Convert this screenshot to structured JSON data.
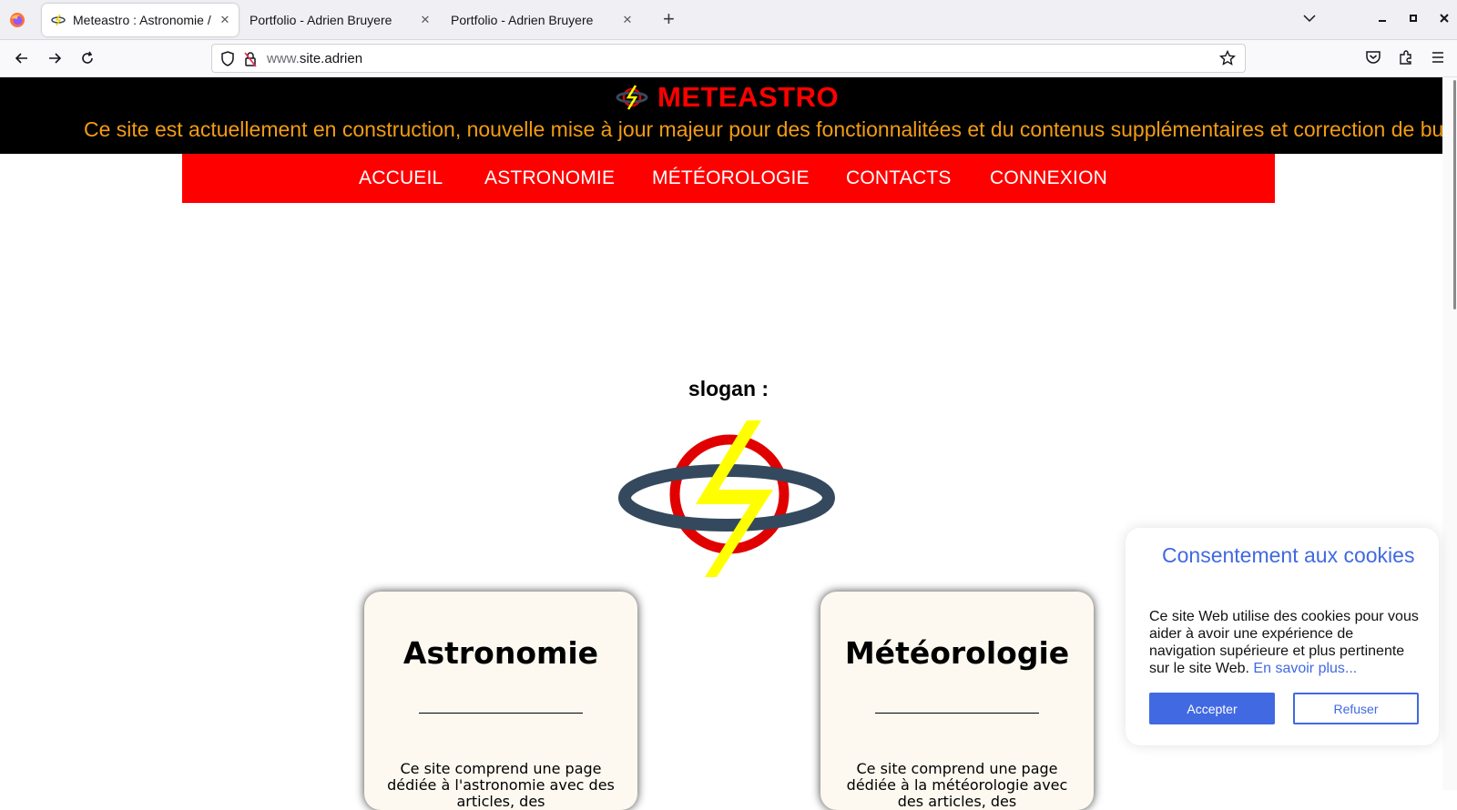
{
  "browser": {
    "tabs": [
      {
        "label": "Meteastro : Astronomie / Météorologie",
        "active": true
      },
      {
        "label": "Portfolio - Adrien Bruyere",
        "active": false
      },
      {
        "label": "Portfolio - Adrien Bruyere",
        "active": false
      }
    ],
    "url_prefix": "www.",
    "url_domain": "site.adrien"
  },
  "header": {
    "brand": "METEASTRO",
    "announcement": "Ce site est actuellement en construction, nouvelle mise à jour majeur pour des fonctionnalitées et du contenus supplémentaires et correction de bugs."
  },
  "nav": {
    "items": [
      "ACCUEIL",
      "ASTRONOMIE",
      "MÉTÉOROLOGIE",
      "CONTACTS",
      "CONNEXION"
    ]
  },
  "main": {
    "slogan": "slogan :",
    "cards": [
      {
        "title": "Astronomie",
        "text": "Ce site comprend une page dédiée à l'astronomie avec des articles, des"
      },
      {
        "title": "Météorologie",
        "text": "Ce site comprend une page dédiée à la météorologie avec des articles, des"
      }
    ]
  },
  "cookie": {
    "title": "Consentement aux cookies",
    "message": "Ce site Web utilise des cookies pour vous aider à avoir une expérience de navigation supérieure et plus pertinente sur le site Web.",
    "learn_more": "En savoir plus...",
    "accept": "Accepter",
    "refuse": "Refuser"
  },
  "colors": {
    "brand_red": "#ff0000",
    "announcement_orange": "#f39c12",
    "cookie_blue": "#4169e1",
    "card_bg": "#fdf9f0",
    "logo_ring": "#34495e",
    "logo_bolt": "#ffff00"
  },
  "icons": [
    "firefox-icon",
    "back-icon",
    "forward-icon",
    "reload-icon",
    "shield-icon",
    "lock-warning-icon",
    "star-icon",
    "pocket-icon",
    "extensions-icon",
    "menu-icon",
    "close-icon",
    "plus-icon",
    "chevron-down-icon"
  ]
}
